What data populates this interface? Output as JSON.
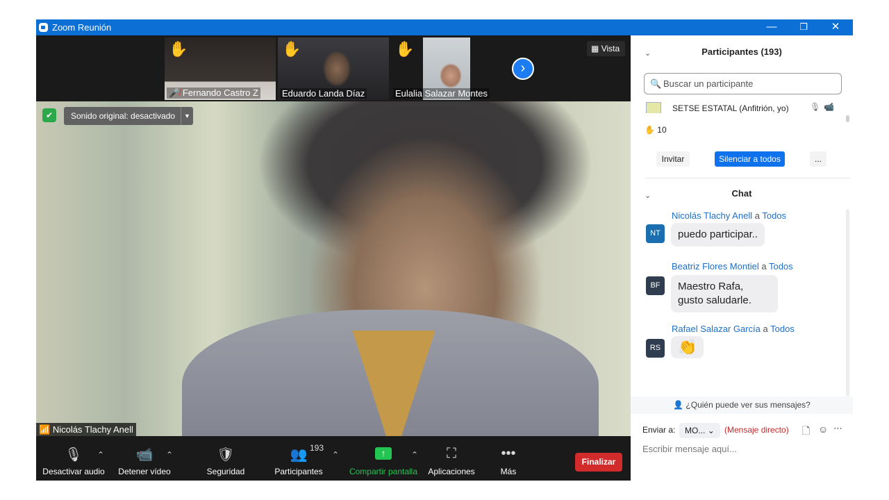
{
  "window": {
    "title": "Zoom Reunión",
    "minimize": "—",
    "restore": "❐",
    "close": "✕"
  },
  "thumbnails": [
    {
      "name": "Fernando Castro Z",
      "hand": "✋"
    },
    {
      "name": "Eduardo Landa Díaz",
      "hand": "✋"
    },
    {
      "name": "Eulalia Salazar Montes",
      "hand": "✋"
    }
  ],
  "view": {
    "label": "Vista"
  },
  "main_video": {
    "sound_label": "Sonido original: desactivado",
    "speaker": "Nicolás Tlachy Anell"
  },
  "toolbar": {
    "audio": "Desactivar audio",
    "video": "Detener vídeo",
    "security": "Seguridad",
    "participants": "Participantes",
    "participants_count": "193",
    "share": "Compartir pantalla",
    "apps": "Aplicaciones",
    "more": "Más",
    "end": "Finalizar"
  },
  "participants_panel": {
    "title": "Participantes (193)",
    "search_placeholder": "Buscar un participante",
    "host_row": "SETSE ESTATAL (Anfitrión, yo)",
    "raised_hands": "10",
    "invite": "Invitar",
    "mute_all": "Silenciar a todos",
    "more": "..."
  },
  "chat": {
    "title": "Chat",
    "messages": [
      {
        "sender": "Nicolás Tlachy Anell",
        "to_word": "a",
        "recipient": "Todos",
        "initials": "NT",
        "text": "puedo participar..",
        "color": "#1b6fb0"
      },
      {
        "sender": "Beatriz Flores Montiel",
        "to_word": "a",
        "recipient": "Todos",
        "initials": "BF",
        "text": "Maestro Rafa, gusto saludarle.",
        "color": "#2f3d4f"
      },
      {
        "sender": "Rafael Salazar García",
        "to_word": "a",
        "recipient": "Todos",
        "initials": "RS",
        "text": "👏",
        "color": "#2f3d4f"
      }
    ],
    "who_sees": "¿Quién puede ver sus mensajes?",
    "send_to_label": "Enviar a:",
    "recipient": "MO...",
    "direct": "(Mensaje directo)",
    "input_placeholder": "Escribir mensaje aquí..."
  },
  "colors": {
    "titlebar": "#0b6fd6",
    "end_button": "#d12b2b",
    "share_icon": "#23c552",
    "mute_all": "#0e72ed"
  }
}
